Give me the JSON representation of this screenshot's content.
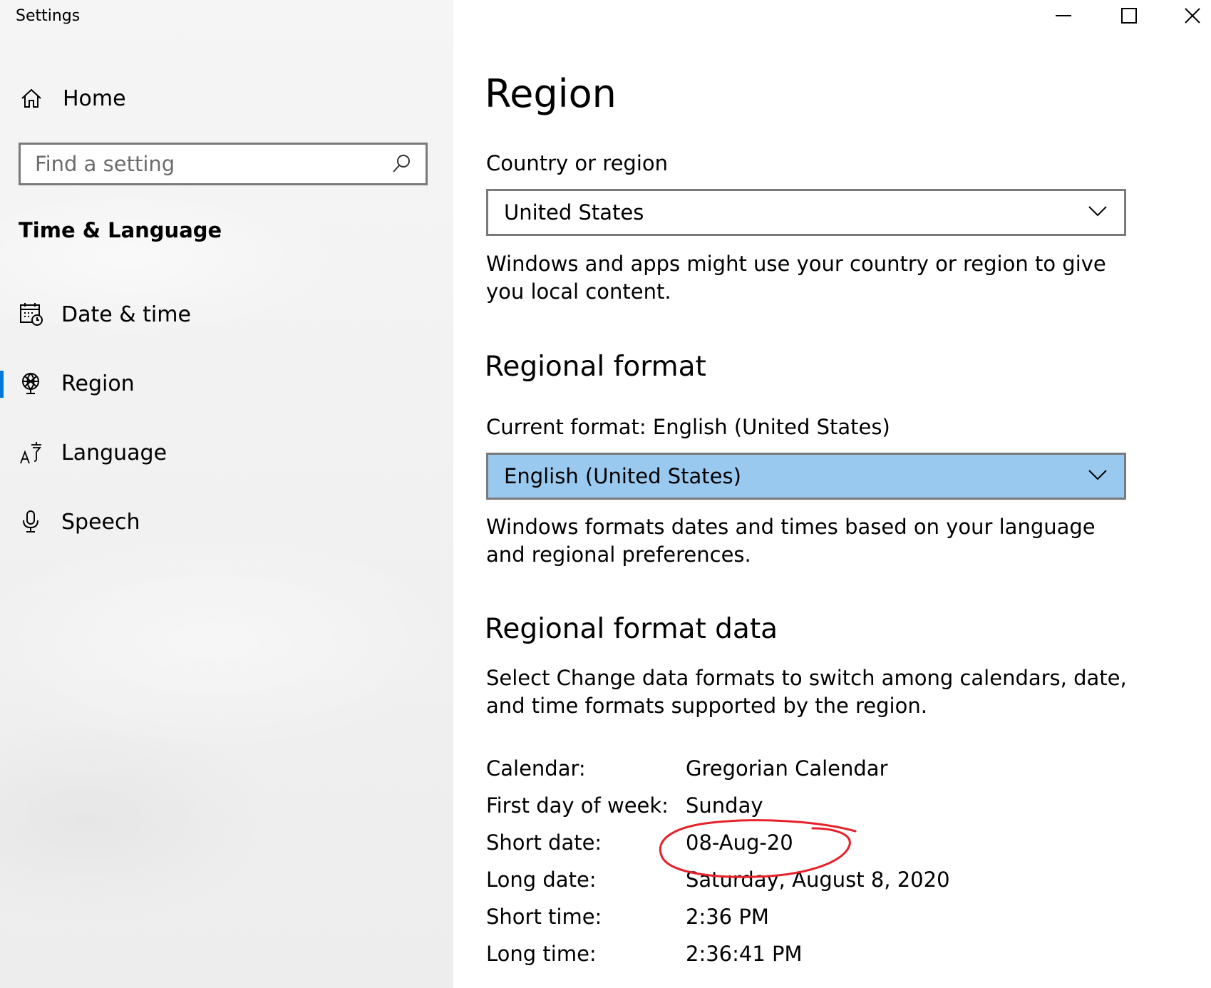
{
  "window": {
    "title": "Settings"
  },
  "sidebar": {
    "home_label": "Home",
    "search": {
      "placeholder": "Find a setting",
      "value": ""
    },
    "section_title": "Time & Language",
    "items": [
      {
        "id": "date-time",
        "label": "Date & time",
        "icon": "calendar-clock-icon"
      },
      {
        "id": "region",
        "label": "Region",
        "icon": "globe-icon",
        "active": true
      },
      {
        "id": "language",
        "label": "Language",
        "icon": "language-icon"
      },
      {
        "id": "speech",
        "label": "Speech",
        "icon": "microphone-icon"
      }
    ]
  },
  "main": {
    "title": "Region",
    "country": {
      "label": "Country or region",
      "selected": "United States",
      "description": "Windows and apps might use your country or region to give you local content."
    },
    "regional_format": {
      "heading": "Regional format",
      "current_label": "Current format: English (United States)",
      "selected": "English (United States)",
      "description": "Windows formats dates and times based on your language and regional preferences."
    },
    "format_data": {
      "heading": "Regional format data",
      "description": "Select Change data formats to switch among calendars, date, and time formats supported by the region.",
      "rows": [
        {
          "key": "Calendar:",
          "value": "Gregorian Calendar"
        },
        {
          "key": "First day of week:",
          "value": "Sunday"
        },
        {
          "key": "Short date:",
          "value": "08-Aug-20"
        },
        {
          "key": "Long date:",
          "value": "Saturday, August 8, 2020"
        },
        {
          "key": "Short time:",
          "value": "2:36 PM"
        },
        {
          "key": "Long time:",
          "value": "2:36:41 PM"
        }
      ]
    }
  },
  "colors": {
    "accent": "#0078d7",
    "dropdown_highlight": "#99c9ef",
    "annotation": "#e8202a"
  }
}
